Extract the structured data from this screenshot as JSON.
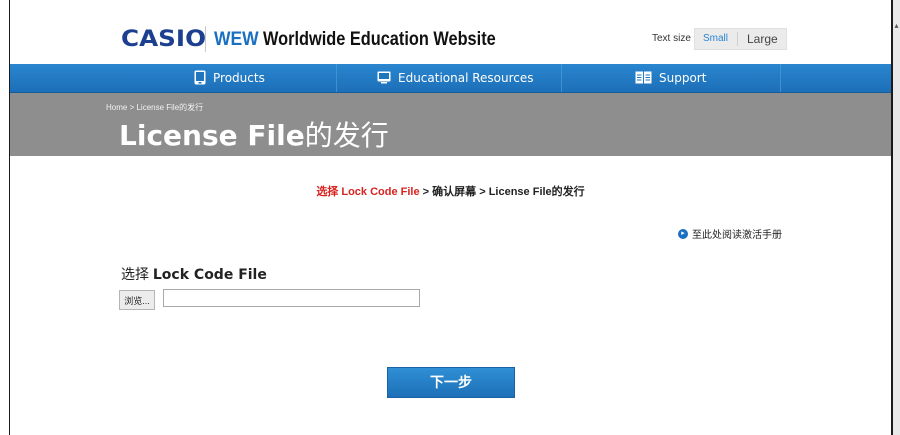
{
  "header": {
    "logo_casio": "CASIO",
    "logo_wew": "WEW",
    "site_title": "Worldwide Education Website",
    "text_size_label": "Text size",
    "text_size_small": "Small",
    "text_size_large": "Large"
  },
  "nav": {
    "items": [
      {
        "label": "Products",
        "icon": "tablet-icon"
      },
      {
        "label": "Educational Resources",
        "icon": "monitor-icon"
      },
      {
        "label": "Support",
        "icon": "book-icon"
      }
    ]
  },
  "banner": {
    "breadcrumb_home": "Home",
    "breadcrumb_sep": " > ",
    "breadcrumb_current": "License File的发行",
    "title_latin": "License File",
    "title_cjk": "的发行"
  },
  "steps": {
    "step1": "选择 Lock Code File",
    "sep": " > ",
    "step2": "确认屏幕",
    "step3": "License File的发行"
  },
  "manual_link": "至此处阅读激活手册",
  "form": {
    "section_prefix": "选择 ",
    "section_bold": "Lock Code File",
    "browse_label": "浏览...",
    "file_value": ""
  },
  "next_button": "下一步",
  "colors": {
    "accent_blue": "#1c6fb8",
    "step_current_red": "#d8231f",
    "banner_gray": "#8e8e8e"
  }
}
